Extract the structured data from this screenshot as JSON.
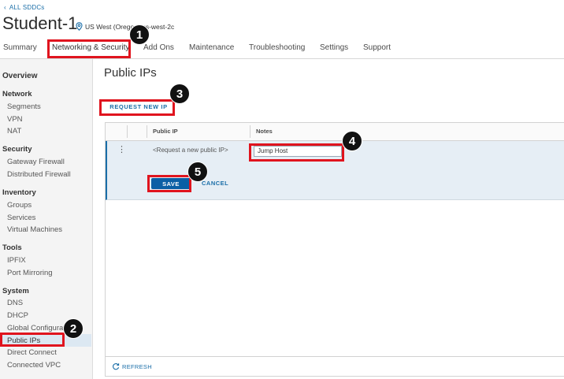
{
  "header": {
    "back_link": "ALL SDDCs",
    "title": "Student-1",
    "region": "US West (Oregon) us-west-2c"
  },
  "tabs": [
    {
      "label": "Summary"
    },
    {
      "label": "Networking & Security"
    },
    {
      "label": "Add Ons"
    },
    {
      "label": "Maintenance"
    },
    {
      "label": "Troubleshooting"
    },
    {
      "label": "Settings"
    },
    {
      "label": "Support"
    }
  ],
  "sidebar": {
    "overview": "Overview",
    "network": {
      "heading": "Network",
      "items": [
        "Segments",
        "VPN",
        "NAT"
      ]
    },
    "security": {
      "heading": "Security",
      "items": [
        "Gateway Firewall",
        "Distributed Firewall"
      ]
    },
    "inventory": {
      "heading": "Inventory",
      "items": [
        "Groups",
        "Services",
        "Virtual Machines"
      ]
    },
    "tools": {
      "heading": "Tools",
      "items": [
        "IPFIX",
        "Port Mirroring"
      ]
    },
    "system": {
      "heading": "System",
      "items": [
        "DNS",
        "DHCP",
        "Global Configuration",
        "Public IPs",
        "Direct Connect",
        "Connected VPC"
      ]
    }
  },
  "main": {
    "title": "Public IPs",
    "request_button": "REQUEST NEW IP",
    "columns": [
      "Public IP",
      "Notes"
    ],
    "edit_row": {
      "public_ip_placeholder": "<Request a new public IP>",
      "notes_value": "Jump Host",
      "save": "SAVE",
      "cancel": "CANCEL"
    },
    "refresh": "REFRESH"
  },
  "callouts": [
    "1",
    "2",
    "3",
    "4",
    "5"
  ],
  "colors": {
    "accent": "#1a6ea8",
    "highlight": "#e0141e",
    "save_button": "#0b5fa5"
  }
}
